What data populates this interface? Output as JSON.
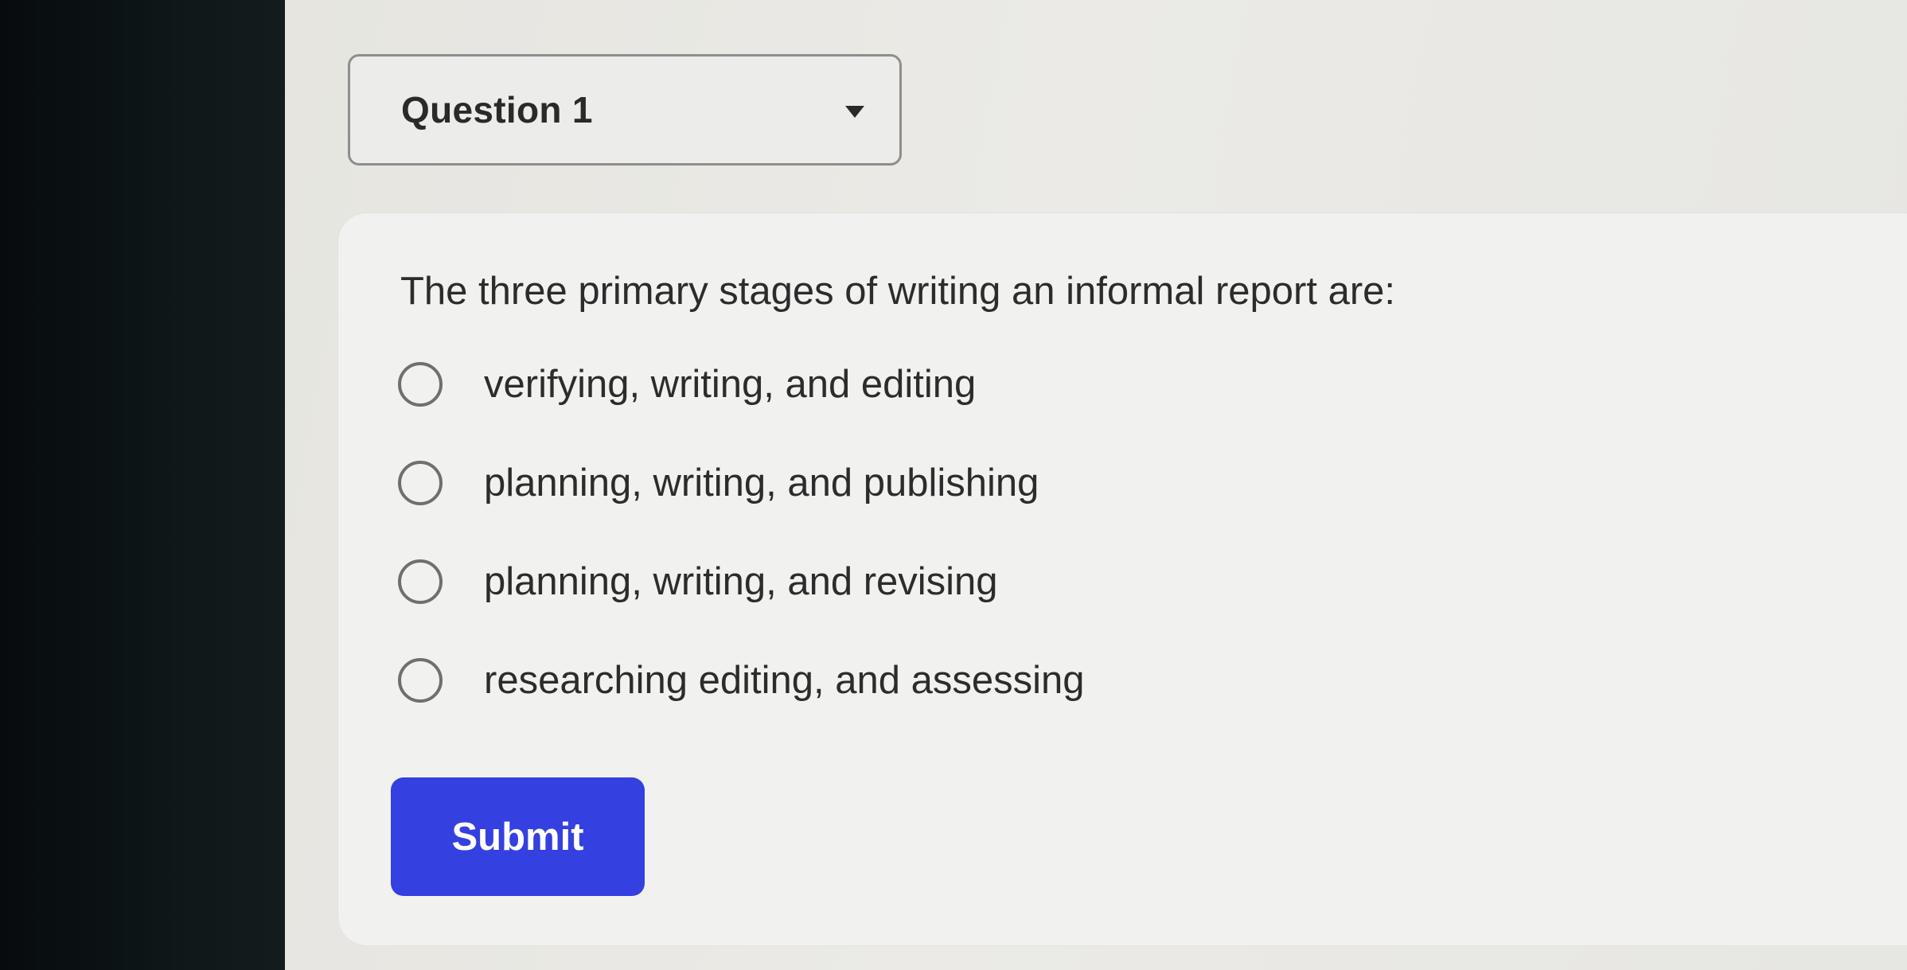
{
  "question_selector": {
    "label": "Question 1",
    "icon": "caret-down-icon"
  },
  "question": {
    "prompt": "The three primary stages of writing an informal report are:",
    "options": [
      {
        "label": "verifying, writing, and editing",
        "selected": false
      },
      {
        "label": "planning, writing, and publishing",
        "selected": false
      },
      {
        "label": "planning, writing, and revising",
        "selected": false
      },
      {
        "label": "researching editing, and assessing",
        "selected": false
      }
    ]
  },
  "submit": {
    "label": "Submit",
    "color": "#3440e0"
  },
  "colors": {
    "page_background": "#e9e8e4",
    "card_background": "#f1f1ef",
    "text": "#2c2c2c",
    "radio_border": "#6f6f6d"
  }
}
